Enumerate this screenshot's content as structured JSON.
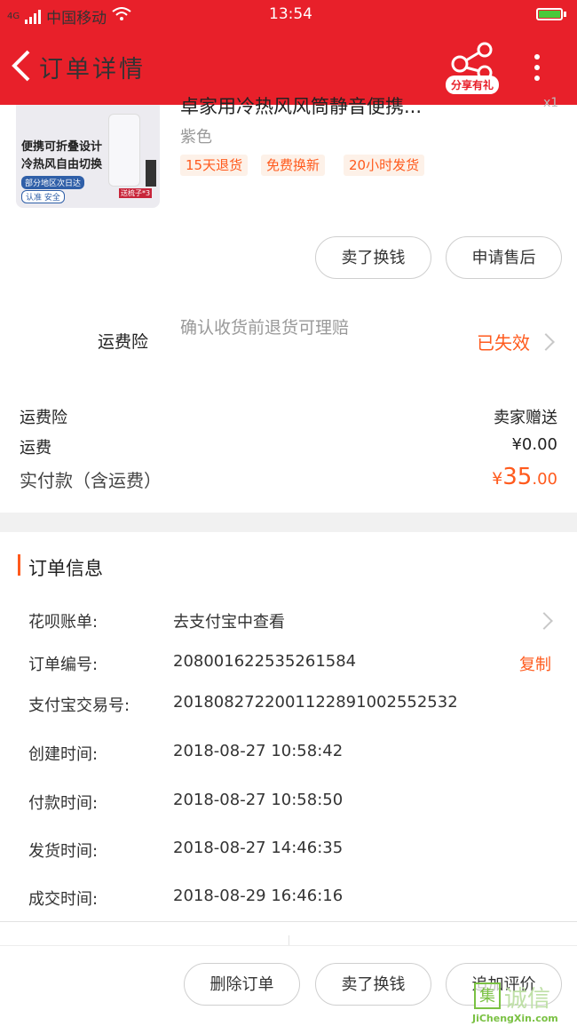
{
  "status_bar": {
    "carrier": "中国移动",
    "network": "4G",
    "time": "13:54"
  },
  "header": {
    "title": "订单详情",
    "share_label": "分享有礼"
  },
  "product": {
    "title": "卓家用冷热风风筒静音便携...",
    "qty": "x1",
    "color": "紫色",
    "thumb_line1": "便携可折叠设计",
    "thumb_line2": "冷热风自由切换",
    "thumb_badge": "部分地区次日达",
    "thumb_cert": "认准 安全",
    "thumb_gift": "送梳子*3",
    "tags": [
      "15天退货",
      "免费换新",
      "20小时发货"
    ]
  },
  "item_actions": {
    "sell": "卖了换钱",
    "after_sale": "申请售后"
  },
  "insurance": {
    "label": "运费险",
    "desc": "确认收货前退货可理赔",
    "status": "已失效"
  },
  "summary": {
    "rows": [
      {
        "label": "运费险",
        "value": "卖家赠送"
      },
      {
        "label": "运费",
        "value": "¥0.00"
      }
    ],
    "total_label": "实付款（含运费）",
    "total_currency": "¥",
    "total_int": "35",
    "total_dec": ".00"
  },
  "order_info": {
    "title": "订单信息",
    "rows": [
      {
        "label": "花呗账单:",
        "value": "去支付宝中查看"
      },
      {
        "label": "订单编号:",
        "value": "208001622535261584"
      },
      {
        "label": "支付宝交易号:",
        "value": "2018082722001122891002552532"
      },
      {
        "label": "创建时间:",
        "value": "2018-08-27 10:58:42"
      },
      {
        "label": "付款时间:",
        "value": "2018-08-27 10:58:50"
      },
      {
        "label": "发货时间:",
        "value": "2018-08-27 14:46:35"
      },
      {
        "label": "成交时间:",
        "value": "2018-08-29 16:46:16"
      }
    ],
    "copy_label": "复制"
  },
  "bottom_actions": {
    "delete": "删除订单",
    "sell": "卖了换钱",
    "review": "追加评价"
  },
  "watermark": {
    "text": "诚信",
    "url": "JiChengXin.com"
  },
  "colors": {
    "brand_red": "#e8202a",
    "accent_orange": "#ff5a1d"
  }
}
